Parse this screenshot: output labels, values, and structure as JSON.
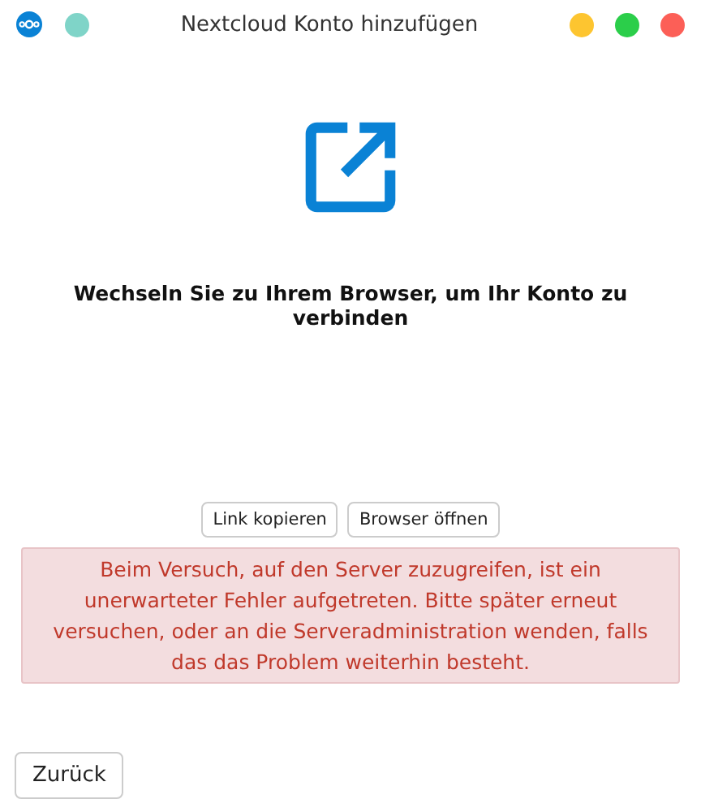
{
  "window": {
    "title": "Nextcloud Konto hinzufügen"
  },
  "heading": "Wechseln Sie zu Ihrem Browser, um Ihr Konto zu verbinden",
  "buttons": [
    "Link kopieren",
    "Browser öffnen"
  ],
  "error": "Beim Versuch, auf den Server zuzugreifen, ist ein unerwarteter Fehler aufgetreten. Bitte später erneut versuchen, oder an die Serveradministration wenden, falls das das Problem weiterhin besteht.",
  "back_button": "Zurück"
}
